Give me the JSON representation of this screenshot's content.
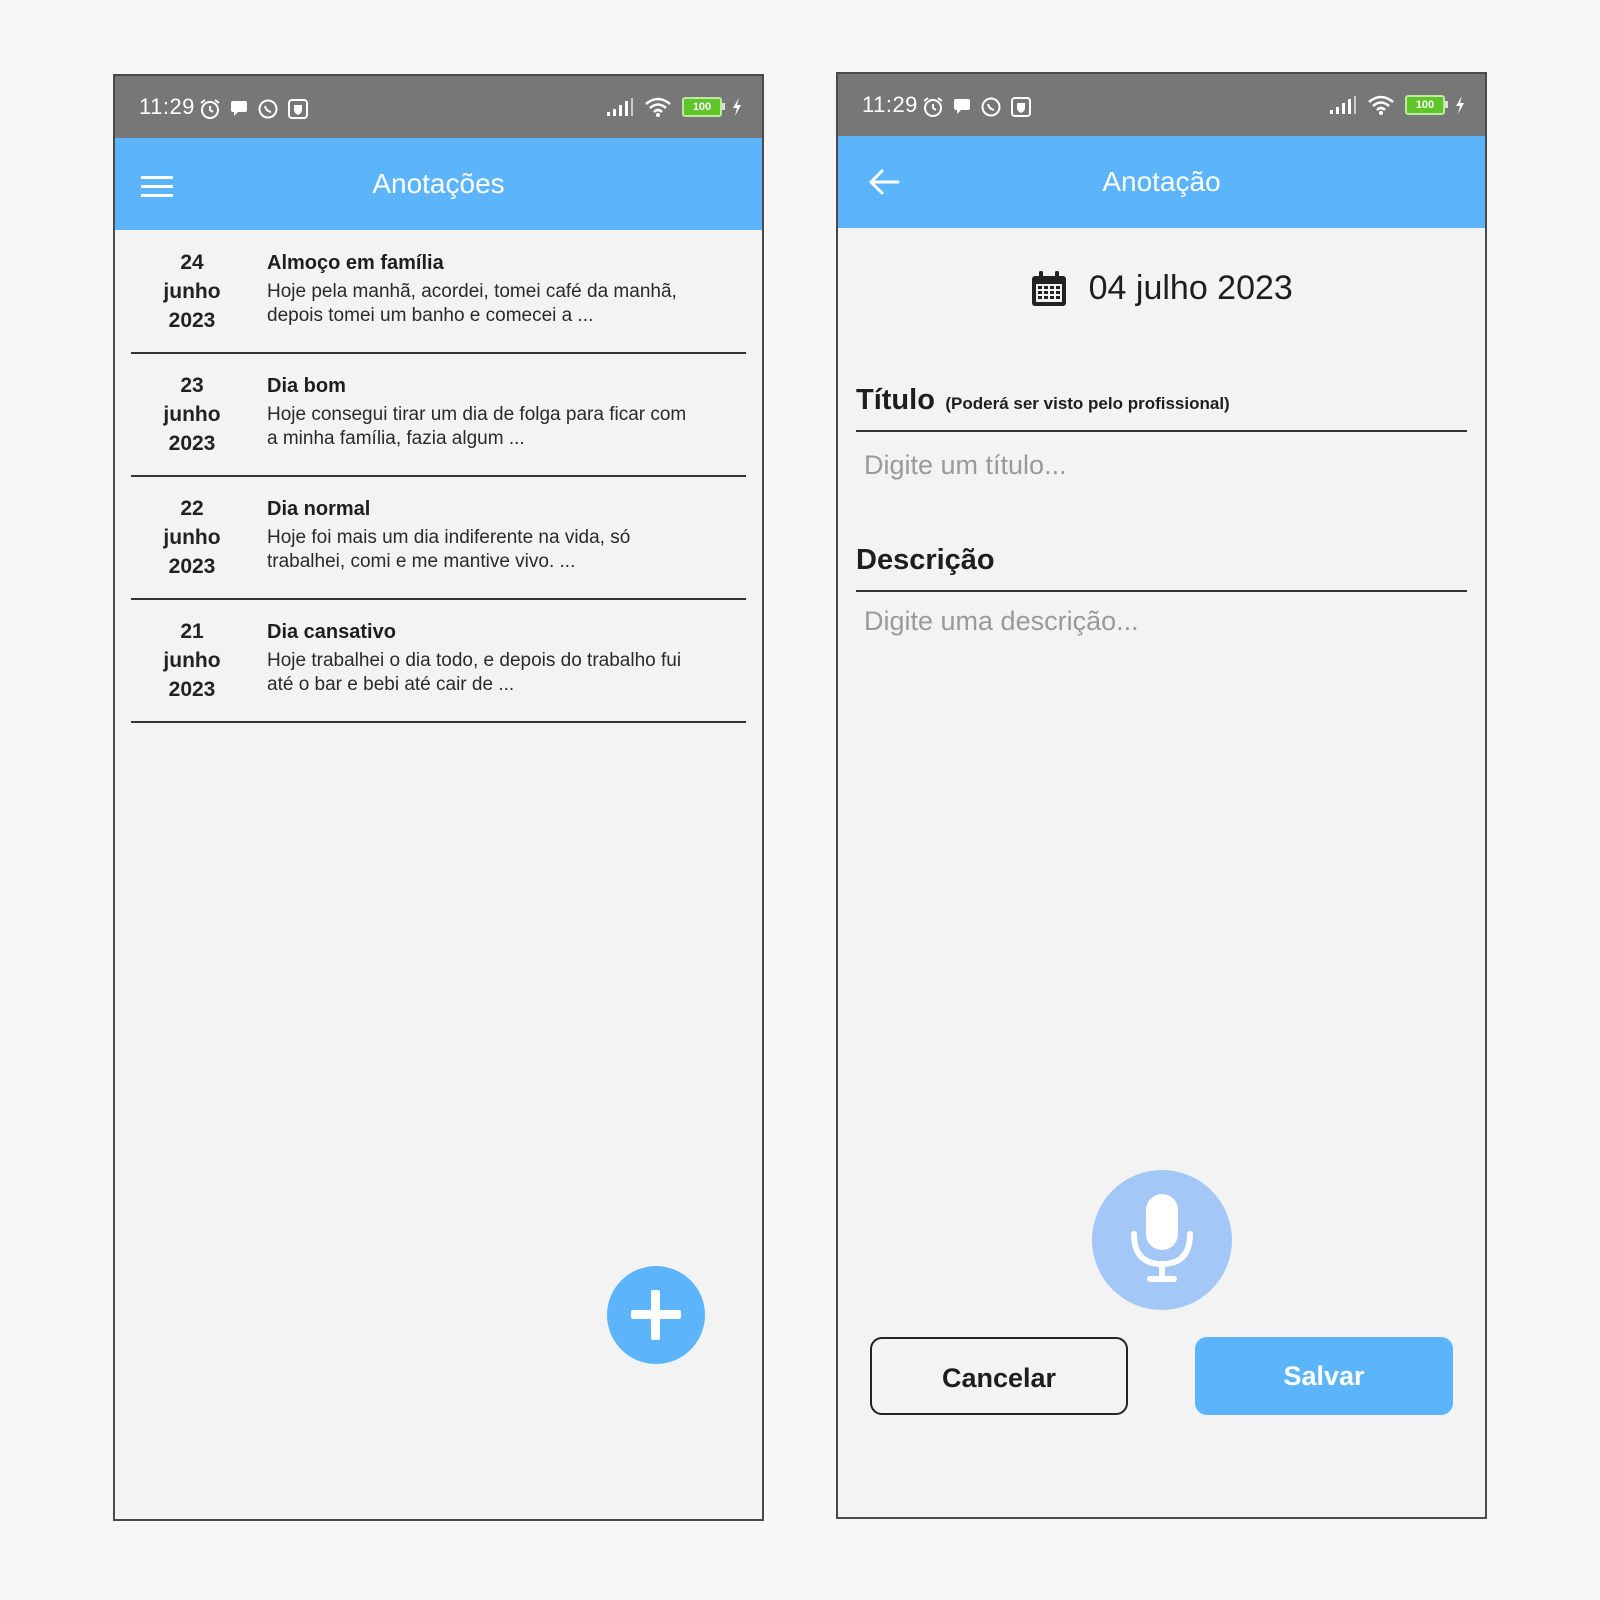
{
  "status_bar": {
    "time": "11:29",
    "battery": "100"
  },
  "list_screen": {
    "title": "Anotações",
    "notes": [
      {
        "day": "24",
        "month": "junho",
        "year": "2023",
        "title": "Almoço em família",
        "desc_line1": "Hoje pela manhã, acordei, tomei café da manhã,",
        "desc_line2": "depois tomei um banho e comecei a ..."
      },
      {
        "day": "23",
        "month": "junho",
        "year": "2023",
        "title": "Dia bom",
        "desc_line1": "Hoje consegui tirar um dia de folga para ficar com",
        "desc_line2": "a minha família, fazia algum  ..."
      },
      {
        "day": "22",
        "month": "junho",
        "year": "2023",
        "title": "Dia normal",
        "desc_line1": "Hoje foi mais um dia indiferente na vida, só",
        "desc_line2": "trabalhei, comi e me mantive vivo.  ..."
      },
      {
        "day": "21",
        "month": "junho",
        "year": "2023",
        "title": "Dia cansativo",
        "desc_line1": "Hoje trabalhei o dia todo, e depois do trabalho fui",
        "desc_line2": "até o bar e bebi até cair de ..."
      }
    ],
    "fab_icon": "plus-icon"
  },
  "edit_screen": {
    "title": "Anotação",
    "date": "04 julho 2023",
    "titulo_label": "Título",
    "titulo_hint": "(Poderá ser visto pelo profissional)",
    "titulo_placeholder": "Digite um título...",
    "descricao_label": "Descrição",
    "descricao_placeholder": "Digite uma descrição...",
    "cancel_label": "Cancelar",
    "save_label": "Salvar"
  },
  "colors": {
    "accent": "#5cb4fb",
    "mic": "#a3c8f7",
    "status_bar": "#777777",
    "battery": "#5fc62a"
  }
}
